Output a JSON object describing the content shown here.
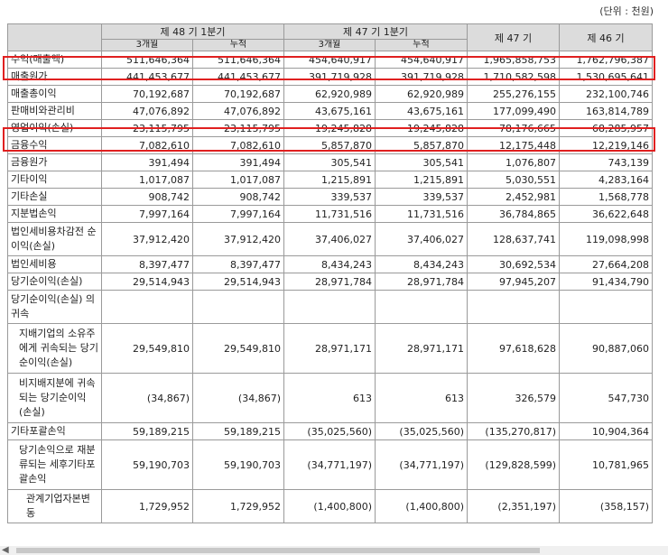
{
  "unit_note": "(단위 : 천원)",
  "header": {
    "p48_q1": "제 48 기 1분기",
    "p47_q1": "제 47 기 1분기",
    "p47": "제 47 기",
    "p46": "제 46 기",
    "three_month": "3개월",
    "cumulative": "누적"
  },
  "rows": [
    {
      "label": "수익(매출액)",
      "v": [
        "511,646,364",
        "511,646,364",
        "454,640,917",
        "454,640,917",
        "1,965,858,753",
        "1,762,796,387"
      ]
    },
    {
      "label": "매출원가",
      "v": [
        "441,453,677",
        "441,453,677",
        "391,719,928",
        "391,719,928",
        "1,710,582,598",
        "1,530,695,641"
      ]
    },
    {
      "label": "매출총이익",
      "v": [
        "70,192,687",
        "70,192,687",
        "62,920,989",
        "62,920,989",
        "255,276,155",
        "232,100,746"
      ]
    },
    {
      "label": "판매비와관리비",
      "v": [
        "47,076,892",
        "47,076,892",
        "43,675,161",
        "43,675,161",
        "177,099,490",
        "163,814,789"
      ]
    },
    {
      "label": "영업이익(손실)",
      "v": [
        "23,115,795",
        "23,115,795",
        "19,245,828",
        "19,245,828",
        "78,176,665",
        "68,285,957"
      ]
    },
    {
      "label": "금융수익",
      "v": [
        "7,082,610",
        "7,082,610",
        "5,857,870",
        "5,857,870",
        "12,175,448",
        "12,219,146"
      ]
    },
    {
      "label": "금융원가",
      "v": [
        "391,494",
        "391,494",
        "305,541",
        "305,541",
        "1,076,807",
        "743,139"
      ]
    },
    {
      "label": "기타이익",
      "v": [
        "1,017,087",
        "1,017,087",
        "1,215,891",
        "1,215,891",
        "5,030,551",
        "4,283,164"
      ]
    },
    {
      "label": "기타손실",
      "v": [
        "908,742",
        "908,742",
        "339,537",
        "339,537",
        "2,452,981",
        "1,568,778"
      ]
    },
    {
      "label": "지분법손익",
      "v": [
        "7,997,164",
        "7,997,164",
        "11,731,516",
        "11,731,516",
        "36,784,865",
        "36,622,648"
      ]
    },
    {
      "label": "법인세비용차감전 순이익(손실)",
      "v": [
        "37,912,420",
        "37,912,420",
        "37,406,027",
        "37,406,027",
        "128,637,741",
        "119,098,998"
      ]
    },
    {
      "label": "법인세비용",
      "v": [
        "8,397,477",
        "8,397,477",
        "8,434,243",
        "8,434,243",
        "30,692,534",
        "27,664,208"
      ]
    },
    {
      "label": "당기순이익(손실)",
      "v": [
        "29,514,943",
        "29,514,943",
        "28,971,784",
        "28,971,784",
        "97,945,207",
        "91,434,790"
      ]
    },
    {
      "label": "당기순이익(손실) 의 귀속",
      "v": [
        "",
        "",
        "",
        "",
        "",
        ""
      ]
    },
    {
      "label": "지배기업의 소유주에게 귀속되는 당기순이익(손실)",
      "v": [
        "29,549,810",
        "29,549,810",
        "28,971,171",
        "28,971,171",
        "97,618,628",
        "90,887,060"
      ]
    },
    {
      "label": "비지배지분에 귀속되는 당기순이익(손실)",
      "v": [
        "(34,867)",
        "(34,867)",
        "613",
        "613",
        "326,579",
        "547,730"
      ]
    },
    {
      "label": "기타포괄손익",
      "v": [
        "59,189,215",
        "59,189,215",
        "(35,025,560)",
        "(35,025,560)",
        "(135,270,817)",
        "10,904,364"
      ]
    },
    {
      "label": "당기손익으로 재분류되는 세후기타포괄손익",
      "v": [
        "59,190,703",
        "59,190,703",
        "(34,771,197)",
        "(34,771,197)",
        "(129,828,599)",
        "10,781,965"
      ]
    },
    {
      "label": "관계기업자본변동",
      "v": [
        "1,729,952",
        "1,729,952",
        "(1,400,800)",
        "(1,400,800)",
        "(2,351,197)",
        "(358,157)"
      ]
    }
  ]
}
